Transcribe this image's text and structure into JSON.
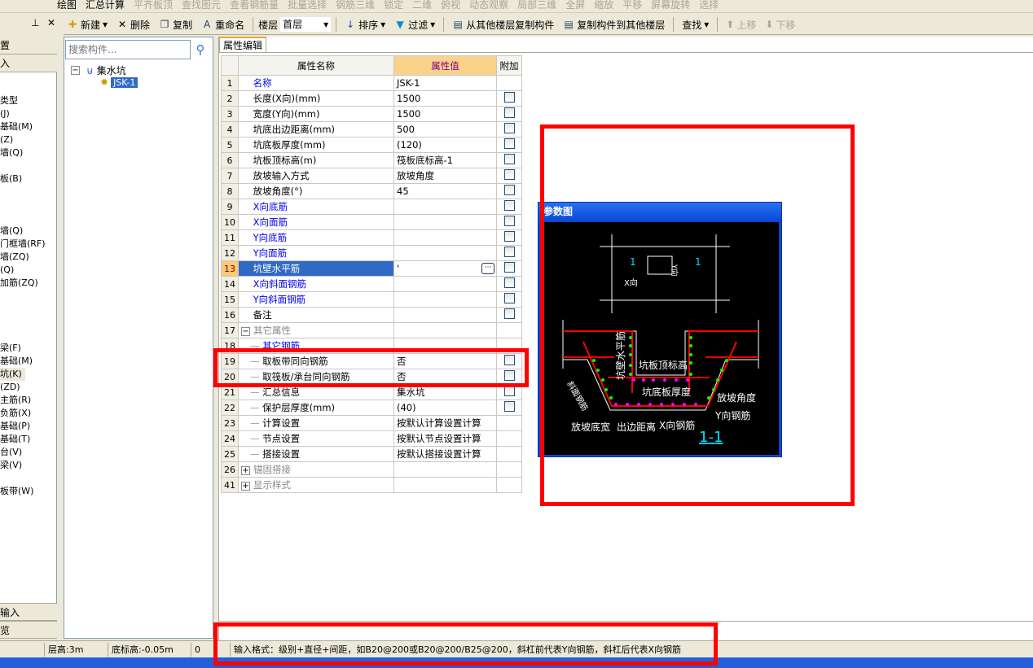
{
  "toolbar1": {
    "items": [
      "绘图",
      "汇总计算",
      "平齐板顶",
      "查找图元",
      "查看钢筋量",
      "批量选择",
      "钢筋三维",
      "锁定",
      "二维",
      "俯视",
      "动态观察",
      "局部三维",
      "全屏",
      "缩放",
      "平移",
      "屏幕旋转",
      "选择"
    ]
  },
  "toolbar2": {
    "new": "新建",
    "delete": "删除",
    "copy": "复制",
    "rename": "重命名",
    "floor_label": "楼层",
    "floor_value": "首层",
    "sort": "排序",
    "filter": "过滤",
    "copy_from": "从其他楼层复制构件",
    "copy_to": "复制构件到其他楼层",
    "find": "查找",
    "move_up": "上移",
    "move_down": "下移"
  },
  "left_panel": {
    "top_buttons": [
      "置",
      "入"
    ],
    "items": [
      "类型",
      "(J)",
      "基础(M)",
      "(Z)",
      "墙(Q)",
      "板(B)",
      "墙(Q)",
      "门框墙(RF)",
      "墙(ZQ)",
      "(Q)",
      "加筋(ZQ)",
      "梁(F)",
      "基础(M)",
      "坑(K)",
      "(ZD)",
      "主筋(R)",
      "负筋(X)",
      "基础(P)",
      "基础(T)",
      "台(V)",
      "梁(V)",
      "板带(W)"
    ],
    "selected": "坑(K)",
    "bottom_buttons": [
      "输入",
      "览"
    ]
  },
  "tree": {
    "search_placeholder": "搜索构件...",
    "root": "集水坑",
    "child": "JSK-1"
  },
  "props": {
    "tab": "属性编辑",
    "headers": [
      "属性名称",
      "属性值",
      "附加"
    ],
    "rows": [
      {
        "n": "1",
        "name": "名称",
        "value": "JSK-1",
        "style": "blue",
        "cb": false
      },
      {
        "n": "2",
        "name": "长度(X向)(mm)",
        "value": "1500",
        "cb": true
      },
      {
        "n": "3",
        "name": "宽度(Y向)(mm)",
        "value": "1500",
        "cb": true
      },
      {
        "n": "4",
        "name": "坑底出边距离(mm)",
        "value": "500",
        "cb": true
      },
      {
        "n": "5",
        "name": "坑底板厚度(mm)",
        "value": "(120)",
        "cb": true
      },
      {
        "n": "6",
        "name": "坑板顶标高(m)",
        "value": "筏板底标高-1",
        "cb": true
      },
      {
        "n": "7",
        "name": "放坡输入方式",
        "value": "放坡角度",
        "cb": true
      },
      {
        "n": "8",
        "name": "放坡角度(°)",
        "value": "45",
        "cb": true
      },
      {
        "n": "9",
        "name": "X向底筋",
        "value": "",
        "style": "blue",
        "cb": true
      },
      {
        "n": "10",
        "name": "X向面筋",
        "value": "",
        "style": "blue",
        "cb": true
      },
      {
        "n": "11",
        "name": "Y向底筋",
        "value": "",
        "style": "blue",
        "cb": true
      },
      {
        "n": "12",
        "name": "Y向面筋",
        "value": "",
        "style": "blue",
        "cb": true
      },
      {
        "n": "13",
        "name": "坑壁水平筋",
        "value": "'",
        "selected": true,
        "cb": true
      },
      {
        "n": "14",
        "name": "X向斜面钢筋",
        "value": "",
        "style": "blue",
        "cb": true
      },
      {
        "n": "15",
        "name": "Y向斜面钢筋",
        "value": "",
        "style": "blue",
        "cb": true
      },
      {
        "n": "16",
        "name": "备注",
        "value": "",
        "cb": true
      },
      {
        "n": "17",
        "name": "其它属性",
        "value": "",
        "style": "gray",
        "group": "-",
        "cb": false
      },
      {
        "n": "18",
        "name": "其它钢筋",
        "value": "",
        "style": "blue",
        "child": true,
        "cb": false
      },
      {
        "n": "19",
        "name": "取板带同向钢筋",
        "value": "否",
        "child": true,
        "cb": true
      },
      {
        "n": "20",
        "name": "取筏板/承台同向钢筋",
        "value": "否",
        "child": true,
        "cb": true
      },
      {
        "n": "21",
        "name": "汇总信息",
        "value": "集水坑",
        "child": true,
        "cb": true
      },
      {
        "n": "22",
        "name": "保护层厚度(mm)",
        "value": "(40)",
        "child": true,
        "cb": true
      },
      {
        "n": "23",
        "name": "计算设置",
        "value": "按默认计算设置计算",
        "child": true,
        "cb": false
      },
      {
        "n": "24",
        "name": "节点设置",
        "value": "按默认节点设置计算",
        "child": true,
        "cb": false
      },
      {
        "n": "25",
        "name": "搭接设置",
        "value": "按默认搭接设置计算",
        "child": true,
        "cb": false
      },
      {
        "n": "26",
        "name": "锚固搭接",
        "value": "",
        "style": "gray",
        "group": "+",
        "cb": false
      },
      {
        "n": "41",
        "name": "显示样式",
        "value": "",
        "style": "gray",
        "group": "+",
        "cb": false
      }
    ]
  },
  "diagram": {
    "title": "参数图",
    "labels": {
      "section_mark": "1",
      "x_dir": "X向",
      "y_dir": "Y向",
      "wall_rebar": "坑壁水平筋",
      "top_elev": "坑板顶标高",
      "bottom_thick": "坑底板厚度",
      "slope_angle": "放坡角度",
      "slope_rebar": "斜面钢筋",
      "y_rebar": "Y向钢筋",
      "x_rebar": "X向钢筋",
      "slope_width": "放坡底宽",
      "edge_dist": "出边距离",
      "section": "1-1"
    }
  },
  "status": {
    "floor_height": "层高:3m",
    "bottom_elev": "底标高:-0.05m",
    "zero": "0",
    "hint": "输入格式：级别+直径+间距，如B20@200或B20@200/B25@200，斜杠前代表Y向钢筋，斜杠后代表X向钢筋"
  },
  "colors": {
    "selection": "#316ac5",
    "annotation": "#ff0000",
    "diagram_bg": "#000000",
    "rebar": "#ff0000"
  }
}
